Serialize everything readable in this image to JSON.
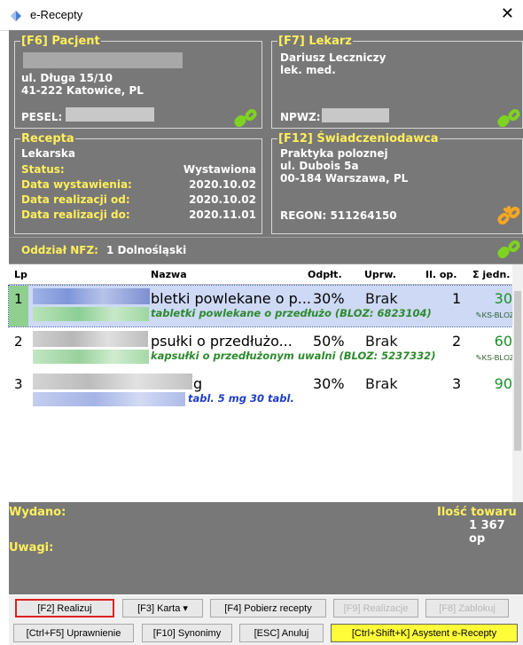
{
  "window": {
    "title": "e-Recepty",
    "close_glyph": "✕"
  },
  "pacjent": {
    "legend": "[F6] Pacjent",
    "address_line1": "ul. Długa 15/10",
    "address_line2": "41-222 Katowice, PL",
    "pesel_label": "PESEL:"
  },
  "lekarz": {
    "legend": "[F7] Lekarz",
    "name": "Dariusz Leczniczy",
    "title": "lek. med.",
    "npwz_label": "NPWZ:"
  },
  "recepta": {
    "legend": "Recepta",
    "type": "Lekarska",
    "status_label": "Status:",
    "status_value": "Wystawiona",
    "wyst_label": "Data wystawienia:",
    "wyst_value": "2020.10.02",
    "od_label": "Data realizacji od:",
    "od_value": "2020.10.02",
    "do_label": "Data realizacji do:",
    "do_value": "2020.11.01"
  },
  "swiadczeniodawca": {
    "legend": "[F12] Świadczeniodawca",
    "line1": "Praktyka polozne​j",
    "line2": "ul. Dubois 5a",
    "line3": "00-184 Warszawa, PL",
    "regon": "REGON: 511264150"
  },
  "oddzial": {
    "label": "Oddział NFZ:",
    "value": "1 Dolnośląski"
  },
  "table": {
    "headers": {
      "lp": "Lp",
      "nazwa": "Nazwa",
      "odplt": "Odpłt.",
      "uprw": "Uprw.",
      "ilop": "Il. op.",
      "jedn": "Σ jedn."
    },
    "rows": [
      {
        "lp": "1",
        "name": "bletki powlekane o p...",
        "sub": "tabletki powlekane o przedłużo (BLOZ: 6823104)",
        "odpl": "30%",
        "upr": "Brak",
        "ilop": "1",
        "jedn": "30",
        "ks": "KS-BLOZ"
      },
      {
        "lp": "2",
        "name": "psułki o przedłużo...",
        "sub": "kapsułki o przedłużonym uwalni (BLOZ: 5237332)",
        "odpl": "50%",
        "upr": "Brak",
        "ilop": "2",
        "jedn": "60",
        "ks": "KS-BLOZ"
      },
      {
        "lp": "3",
        "name": "g",
        "sub": "tabl. 5 mg 30 tabl.",
        "odpl": "30%",
        "upr": "Brak",
        "ilop": "3",
        "jedn": "90",
        "ks": ""
      }
    ]
  },
  "summary": {
    "wydano_label": "Wydano:",
    "ilosc_label": "Ilość towaru",
    "ilosc_value": "1 367 op",
    "uwagi_label": "Uwagi:"
  },
  "buttons": {
    "realizuj": "[F2] Realizuj",
    "karta": "[F3] Karta ▾",
    "pobierz": "[F4] Pobierz recepty",
    "realizacje": "[F9] Realizacje",
    "zablokuj": "[F8] Zablokuj",
    "uprawnienie": "[Ctrl+F5] Uprawnienie",
    "synonimy": "[F10] Synonimy",
    "anuluj": "[ESC] Anuluj",
    "asystent": "[Ctrl+Shift+K] Asystent e-Recepty"
  },
  "colors": {
    "panel_bg": "#787878",
    "label_yellow": "#ffef5a",
    "link_green": "#7ed321",
    "link_orange": "#f5a623",
    "selected_row": "#cdd9f5",
    "qty_green": "#1a8f2a",
    "sub_green": "#2d8a2d",
    "sub_blue": "#1f3fc6",
    "asystent_bg": "#fffd3a"
  },
  "icons": {
    "app": "pill-app-icon",
    "link": "chain-link-icon",
    "link_warn": "chain-link-warning-icon",
    "ks_bloz": "pencil-icon"
  }
}
